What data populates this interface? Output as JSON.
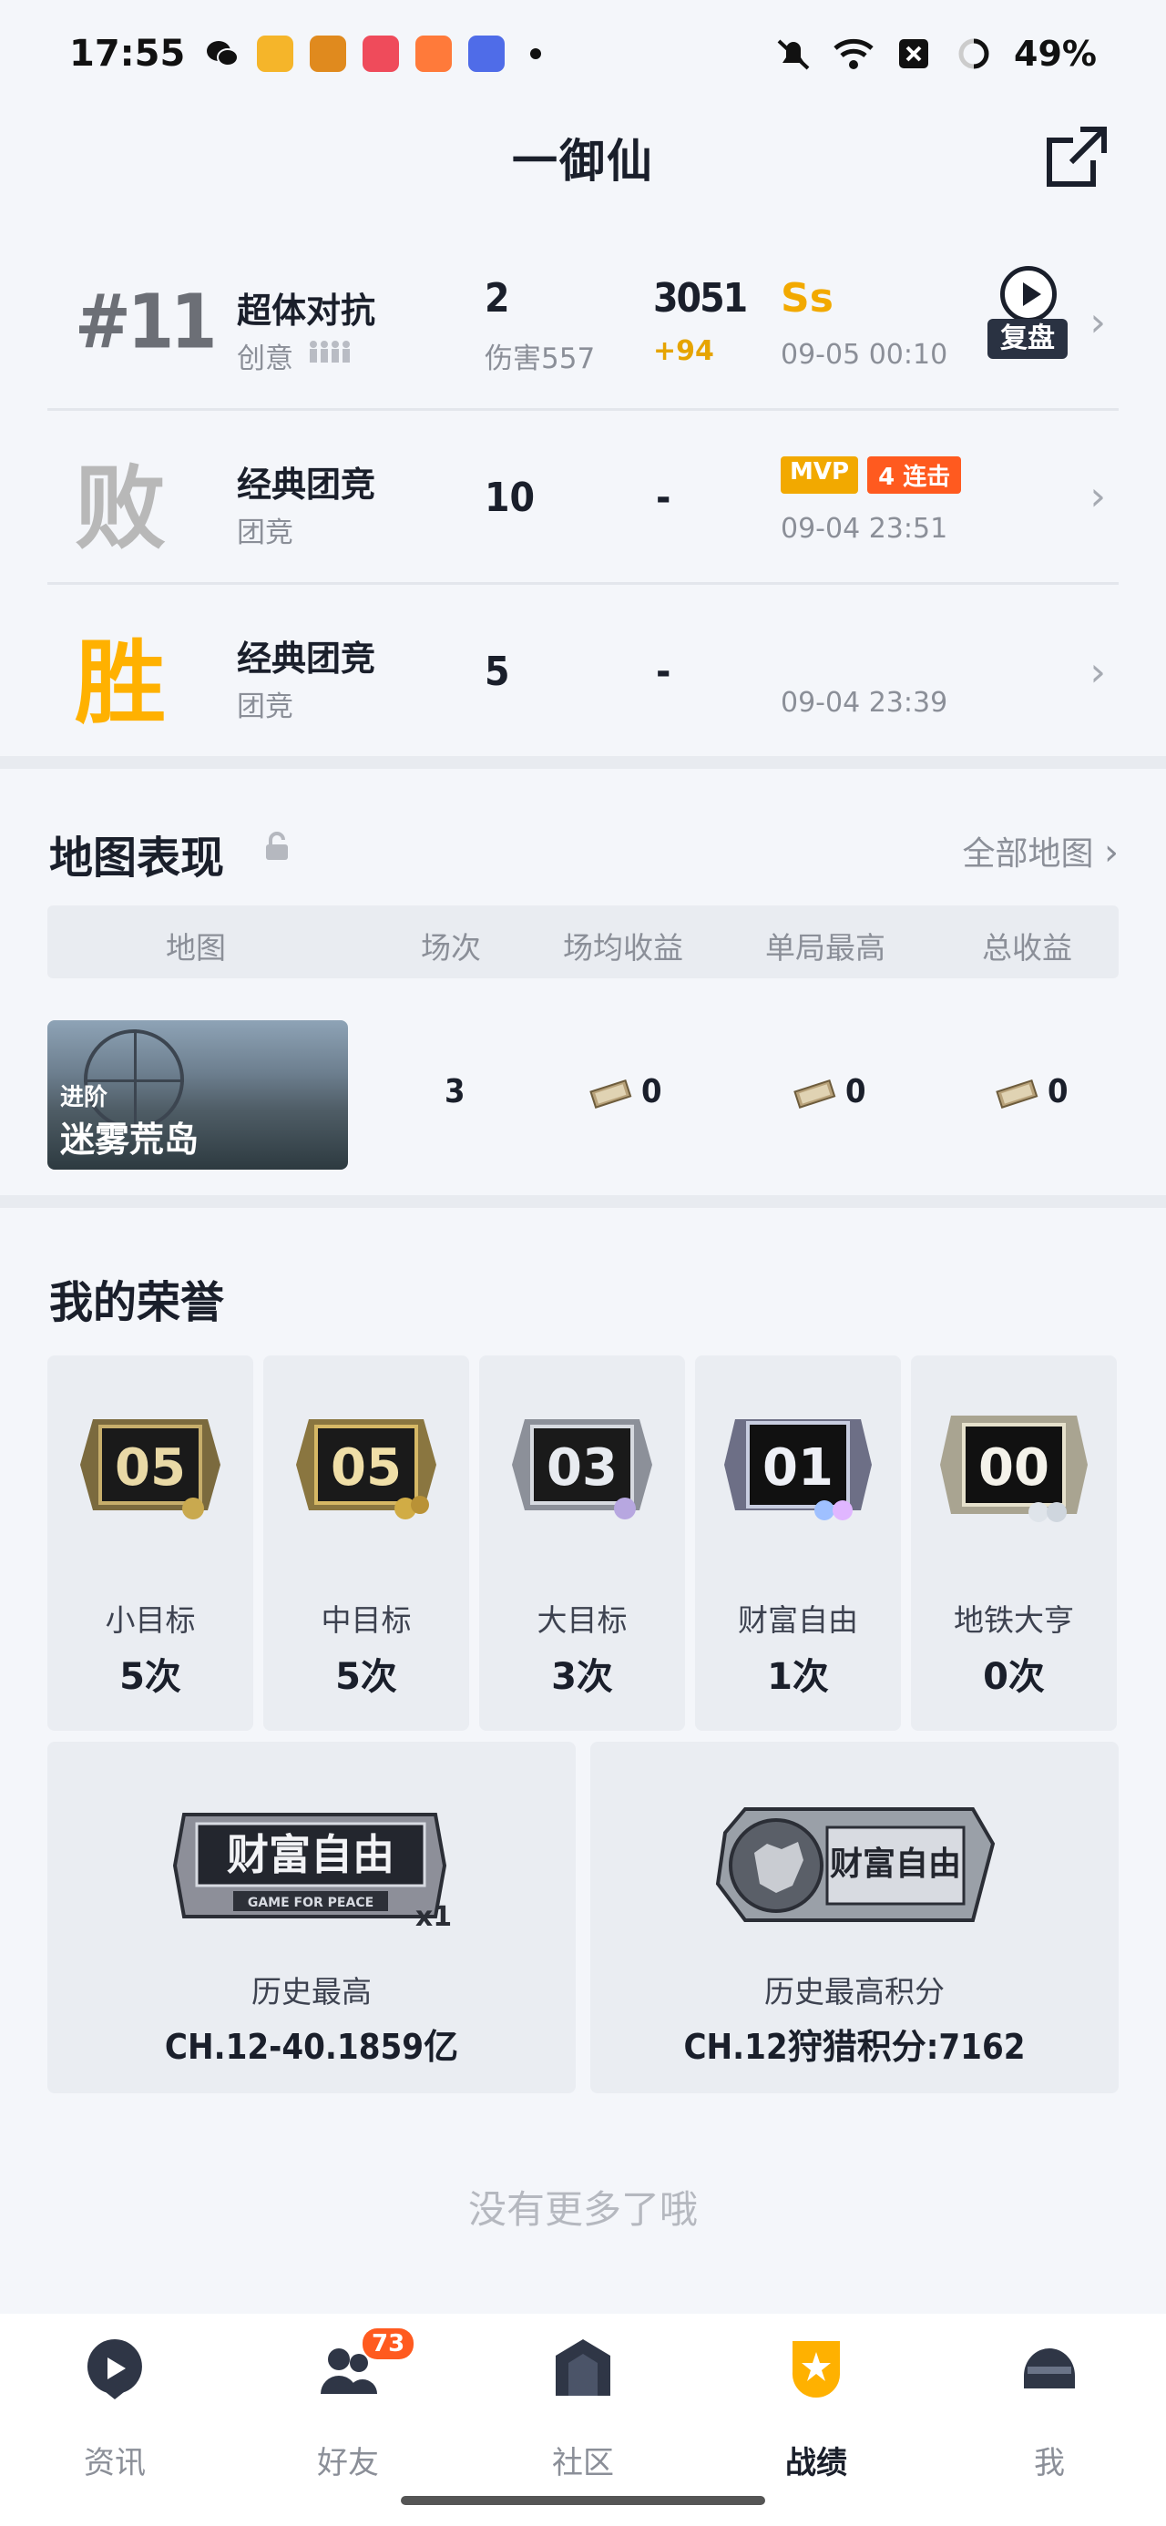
{
  "status_bar": {
    "time": "17:55",
    "battery": "49%"
  },
  "header": {
    "title": "一御仙"
  },
  "matches": [
    {
      "rank": "#11",
      "mode": "超体对抗",
      "sub": "创意",
      "kills": "2",
      "damage": "伤害557",
      "score": "3051",
      "delta": "+94",
      "grade": "Ss",
      "time": "09-05 00:10",
      "replay_label": "复盘"
    },
    {
      "rank": "败",
      "mode": "经典团竞",
      "sub": "团竞",
      "kills": "10",
      "score": "-",
      "mvp": "MVP",
      "streak_num": "4",
      "streak_label": "连击",
      "time": "09-04 23:51"
    },
    {
      "rank": "胜",
      "mode": "经典团竞",
      "sub": "团竞",
      "kills": "5",
      "score": "-",
      "time": "09-04 23:39"
    }
  ],
  "map_section": {
    "title": "地图表现",
    "all_link": "全部地图",
    "columns": [
      "地图",
      "场次",
      "场均收益",
      "单局最高",
      "总收益"
    ],
    "row": {
      "tag": "进阶",
      "name": "迷雾荒岛",
      "games": "3",
      "avg": "0",
      "best": "0",
      "total": "0"
    }
  },
  "honors": {
    "title": "我的荣誉",
    "items": [
      {
        "badge_num": "05",
        "label": "小目标",
        "count": "5次"
      },
      {
        "badge_num": "05",
        "label": "中目标",
        "count": "5次"
      },
      {
        "badge_num": "03",
        "label": "大目标",
        "count": "3次"
      },
      {
        "badge_num": "01",
        "label": "财富自由",
        "count": "1次"
      },
      {
        "badge_num": "00",
        "label": "地铁大亨",
        "count": "0次"
      }
    ],
    "best": [
      {
        "emblem_text": "财富自由",
        "emblem_sub": "GAME FOR PEACE",
        "emblem_mult": "x1",
        "label": "历史最高",
        "value": "CH.12-40.1859亿"
      },
      {
        "emblem_text": "财富自由",
        "label": "历史最高积分",
        "value": "CH.12狩猎积分:7162"
      }
    ]
  },
  "footer_text": "没有更多了哦",
  "nav": [
    {
      "label": "资讯"
    },
    {
      "label": "好友",
      "badge": "73"
    },
    {
      "label": "社区"
    },
    {
      "label": "战绩"
    },
    {
      "label": "我"
    }
  ]
}
